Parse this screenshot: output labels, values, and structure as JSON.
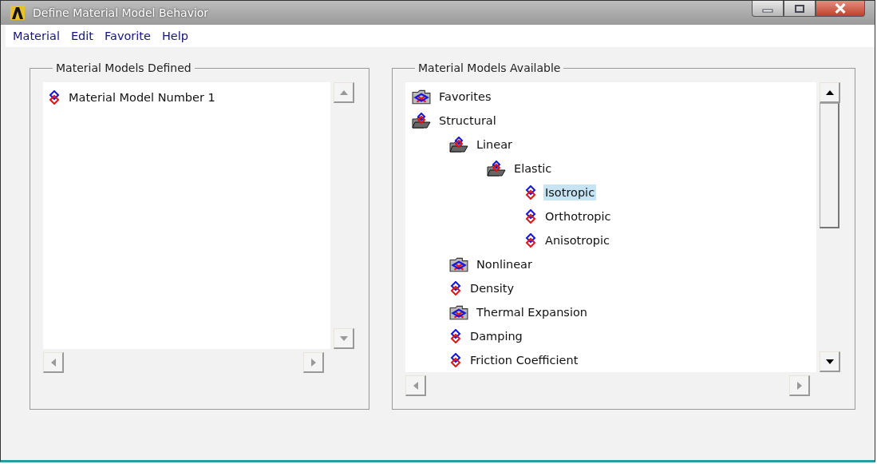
{
  "window": {
    "title": "Define Material Model Behavior"
  },
  "menu": [
    "Material",
    "Edit",
    "Favorite",
    "Help"
  ],
  "defined": {
    "title": "Material Models Defined",
    "items": [
      {
        "label": "Material Model Number 1",
        "selected": false
      }
    ]
  },
  "available": {
    "title": "Material Models Available",
    "tree": [
      {
        "label": "Favorites",
        "kind": "folder",
        "expanded": false,
        "selected": false
      },
      {
        "label": "Structural",
        "kind": "folder",
        "expanded": true,
        "selected": false,
        "children": [
          {
            "label": "Linear",
            "kind": "folder",
            "expanded": true,
            "selected": false,
            "children": [
              {
                "label": "Elastic",
                "kind": "folder",
                "expanded": true,
                "selected": false,
                "children": [
                  {
                    "label": "Isotropic",
                    "kind": "model",
                    "selected": true
                  },
                  {
                    "label": "Orthotropic",
                    "kind": "model",
                    "selected": false
                  },
                  {
                    "label": "Anisotropic",
                    "kind": "model",
                    "selected": false
                  }
                ]
              }
            ]
          },
          {
            "label": "Nonlinear",
            "kind": "folder",
            "expanded": false,
            "selected": false
          },
          {
            "label": "Density",
            "kind": "model",
            "selected": false
          },
          {
            "label": "Thermal Expansion",
            "kind": "folder",
            "expanded": false,
            "selected": false
          },
          {
            "label": "Damping",
            "kind": "model",
            "selected": false
          },
          {
            "label": "Friction Coefficient",
            "kind": "model",
            "selected": false
          }
        ]
      }
    ]
  }
}
